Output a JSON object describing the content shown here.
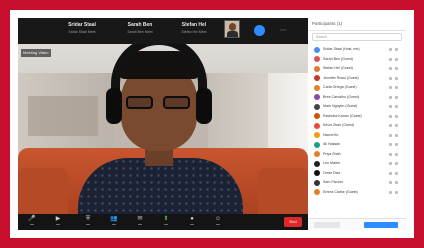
{
  "colors": {
    "border": "#c8102e",
    "zoom_blue": "#2d8cff",
    "end_red": "#e02828"
  },
  "top_tiles": [
    {
      "name": "Sridar Staal",
      "sub": "Sridar Staal Meet"
    },
    {
      "name": "Sarah Ben",
      "sub": "Sarah Ben Meet"
    },
    {
      "name": "Stefan Hel",
      "sub": "Stefan Hel Meet"
    }
  ],
  "top_menu_icon": "more-icon",
  "video_label": "Meeting Video",
  "toolbar": {
    "buttons": [
      {
        "icon": "microphone-icon",
        "glyph": "🎤"
      },
      {
        "icon": "camera-icon",
        "glyph": "▶"
      },
      {
        "icon": "security-icon",
        "glyph": "⛨"
      },
      {
        "icon": "participants-icon",
        "glyph": "👥"
      },
      {
        "icon": "chat-icon",
        "glyph": "✉"
      },
      {
        "icon": "share-screen-icon",
        "glyph": "⬆"
      },
      {
        "icon": "record-icon",
        "glyph": "●"
      },
      {
        "icon": "reactions-icon",
        "glyph": "☺"
      }
    ],
    "end_label": "End"
  },
  "panel": {
    "title": "Participants (1)",
    "search_placeholder": "Search",
    "participants": [
      {
        "name": "Sridar Staal (Host, me)",
        "color": "#4a8ff0"
      },
      {
        "name": "Sarah Ben (Guest)",
        "color": "#d9534f"
      },
      {
        "name": "Stefan Hel (Guest)",
        "color": "#e07a2e"
      },
      {
        "name": "Jennifer Rossi (Guest)",
        "color": "#c0392b"
      },
      {
        "name": "Carla Ortega (Guest)",
        "color": "#e67e22"
      },
      {
        "name": "Bree Carvalho (Guest)",
        "color": "#8e44ad"
      },
      {
        "name": "Mark Nguyen (Guest)",
        "color": "#444444"
      },
      {
        "name": "Ravindra Kanan (Guest)",
        "color": "#d35400"
      },
      {
        "name": "Kevin Zhao (Guest)",
        "color": "#e74c3c"
      },
      {
        "name": "Naomi Ito",
        "color": "#f39c12"
      },
      {
        "name": "Ali Hassan",
        "color": "#16a085"
      },
      {
        "name": "Priya Shah",
        "color": "#e67e22"
      },
      {
        "name": "Leo Martin",
        "color": "#222222"
      },
      {
        "name": "Omar Diaz",
        "color": "#111111"
      },
      {
        "name": "Sam Fischer",
        "color": "#333333"
      },
      {
        "name": "Emma Clarke (Guest)",
        "color": "#e67e22"
      }
    ],
    "footer_buttons": [
      "Invite",
      "Mute All"
    ]
  }
}
